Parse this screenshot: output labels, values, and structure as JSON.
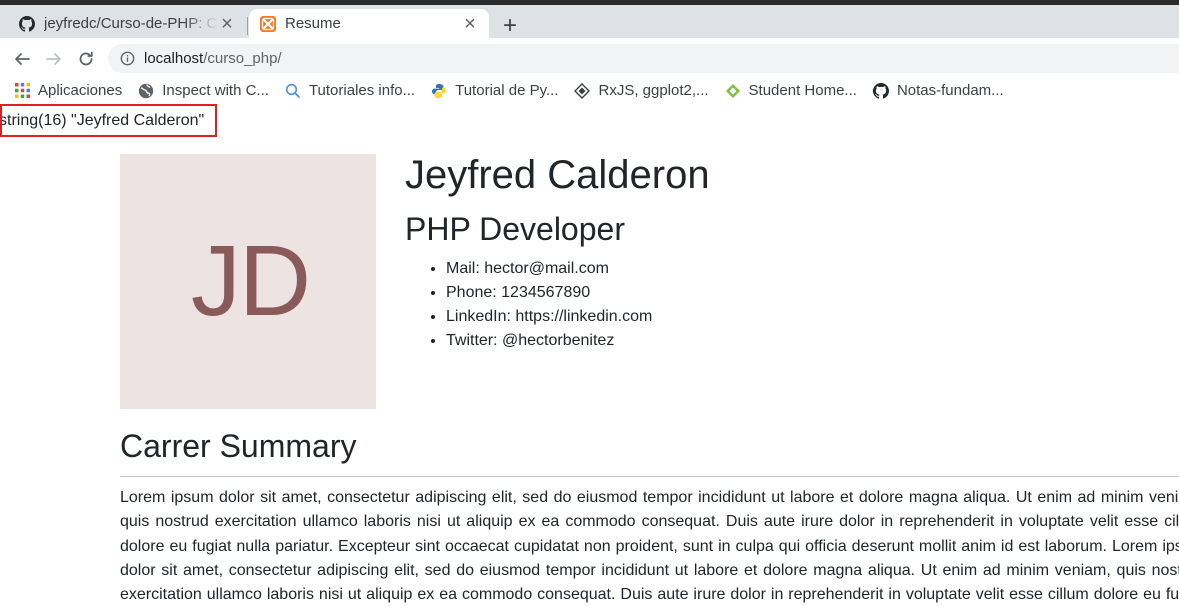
{
  "browser": {
    "tabs": [
      {
        "title": "jeyfredc/Curso-de-PHP: Cu",
        "icon": "github-icon",
        "active": false
      },
      {
        "title": "Resume",
        "icon": "xampp-icon",
        "active": true
      }
    ],
    "url_host": "localhost",
    "url_path": "/curso_php/",
    "bookmarks": [
      {
        "label": "Aplicaciones",
        "icon": "apps-grid-icon"
      },
      {
        "label": "Inspect with C...",
        "icon": "globe-icon"
      },
      {
        "label": "Tutoriales info...",
        "icon": "search-icon"
      },
      {
        "label": "Tutorial de Py...",
        "icon": "python-icon"
      },
      {
        "label": "RxJS, ggplot2,...",
        "icon": "diamond-icon"
      },
      {
        "label": "Student Home...",
        "icon": "student-icon"
      },
      {
        "label": "Notas-fundam...",
        "icon": "github-icon"
      }
    ]
  },
  "page": {
    "var_dump": "string(16) \"Jeyfred Calderon\"",
    "photo_initials": "JD",
    "name": "Jeyfred Calderon",
    "job_title": "PHP Developer",
    "contact": [
      "Mail: hector@mail.com",
      "Phone: 1234567890",
      "LinkedIn: https://linkedin.com",
      "Twitter: @hectorbenitez"
    ],
    "summary_title": "Carrer Summary",
    "summary_text": "Lorem ipsum dolor sit amet, consectetur adipiscing elit, sed do eiusmod tempor incididunt ut labore et dolore magna aliqua. Ut enim ad minim veniam, quis nostrud exercitation ullamco laboris nisi ut aliquip ex ea commodo consequat. Duis aute irure dolor in reprehenderit in voluptate velit esse cillum dolore eu fugiat nulla pariatur. Excepteur sint occaecat cupidatat non proident, sunt in culpa qui officia deserunt mollit anim id est laborum. Lorem ipsum dolor sit amet, consectetur adipiscing elit, sed do eiusmod tempor incididunt ut labore et dolore magna aliqua. Ut enim ad minim veniam, quis nostrud exercitation ullamco laboris nisi ut aliquip ex ea commodo consequat. Duis aute irure dolor in reprehenderit in voluptate velit esse cillum dolore eu fugiat nulla pariatur. Excepteur sint occaecat cupidatat non proident, sunt in culpa qui officia deserunt mollit anim id est laborum."
  },
  "colors": {
    "photo_bg": "#ede3e3",
    "photo_text": "#8a5a5a",
    "highlight_box": "#e02020",
    "tabbar_bg": "#dee1e6"
  }
}
